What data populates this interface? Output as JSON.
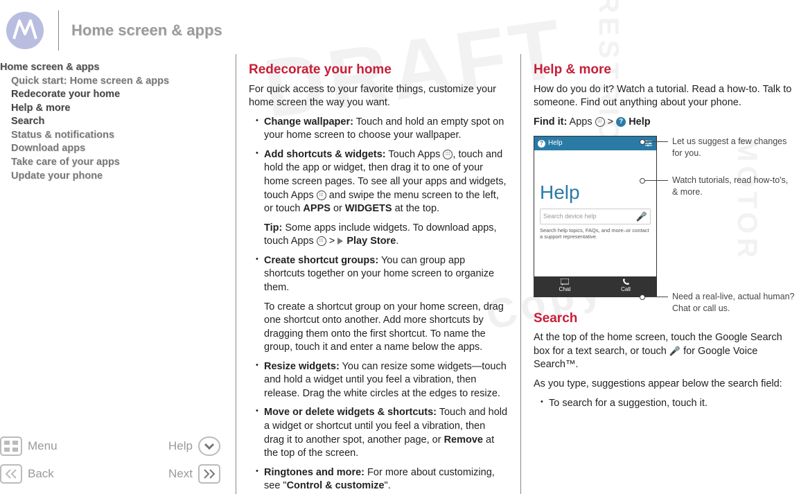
{
  "header": {
    "title": "Home screen & apps"
  },
  "sidebar": {
    "top": "Home screen & apps",
    "items": [
      "Quick start: Home screen & apps",
      "Redecorate your home",
      "Help & more",
      "Search",
      "Status & notifications",
      "Download apps",
      "Take care of your apps",
      "Update your phone"
    ]
  },
  "bottomnav": {
    "menu": "Menu",
    "help": "Help",
    "back": "Back",
    "next": "Next"
  },
  "col1": {
    "h": "Redecorate your home",
    "intro": "For quick access to your favorite things, customize your home screen the way you want.",
    "b1_label": "Change wallpaper:",
    "b1_text": " Touch and hold an empty spot on your home screen to choose your wallpaper.",
    "b2_label": "Add shortcuts & widgets:",
    "b2_text_a": " Touch Apps ",
    "b2_text_b": ", touch and hold the app or widget, then drag it to one of your home screen pages. To see all your apps and widgets, touch Apps ",
    "b2_text_c": " and swipe the menu screen to the left, or touch ",
    "b2_apps": "APPS",
    "b2_or": " or ",
    "b2_widgets": "WIDGETS",
    "b2_text_d": " at the top.",
    "tip_label": "Tip:",
    "tip_text_a": " Some apps include widgets. To download apps, touch Apps ",
    "tip_arrow": " > ",
    "tip_ps": " Play Store",
    "tip_dot": ".",
    "b3_label": "Create shortcut groups:",
    "b3_text": " You can group app shortcuts together on your home screen to organize them.",
    "b3_para": "To create a shortcut group on your home screen, drag one shortcut onto another. Add more shortcuts by dragging them onto the first shortcut. To name the group, touch it and enter a name below the apps.",
    "b4_label": "Resize widgets:",
    "b4_text": " You can resize some widgets—touch and hold a widget until you feel a vibration, then release. Drag the white circles at the edges to resize.",
    "b5_label": "Move or delete widgets & shortcuts:",
    "b5_text_a": " Touch and hold a widget or shortcut until you feel a vibration, then drag it to another spot, another page, or ",
    "b5_remove": "Remove",
    "b5_text_b": " at the top of the screen.",
    "b6_label": "Ringtones and more:",
    "b6_text_a": " For more about customizing, see \"",
    "b6_link": "Control & customize",
    "b6_text_b": "\"."
  },
  "col2": {
    "h": "Help & more",
    "intro": "How do you do it? Watch a tutorial. Read a how-to. Talk to someone. Find out anything about your phone.",
    "find_label": "Find it:",
    "find_a": " Apps ",
    "find_arrow": " > ",
    "find_help": " Help",
    "phone": {
      "topbar_label": "Help",
      "big": "Help",
      "search_ph": "Search device help",
      "hint": "Search help topics, FAQs, and more–or contact a support representative.",
      "chat": "Chat",
      "call": "Call"
    },
    "callouts": {
      "c1": "Let us suggest a few changes for you.",
      "c2": "Watch tutorials, read how-to's, & more.",
      "c3": "Need a real-live, actual human? Chat or call us."
    },
    "search_h": "Search",
    "search_p1_a": "At the top of the home screen, touch the Google Search box for a text search, or touch ",
    "search_p1_b": " for Google Voice Search™.",
    "search_p2": "As you type, suggestions appear below the search field:",
    "search_b1": "To search for a suggestion, touch it."
  }
}
